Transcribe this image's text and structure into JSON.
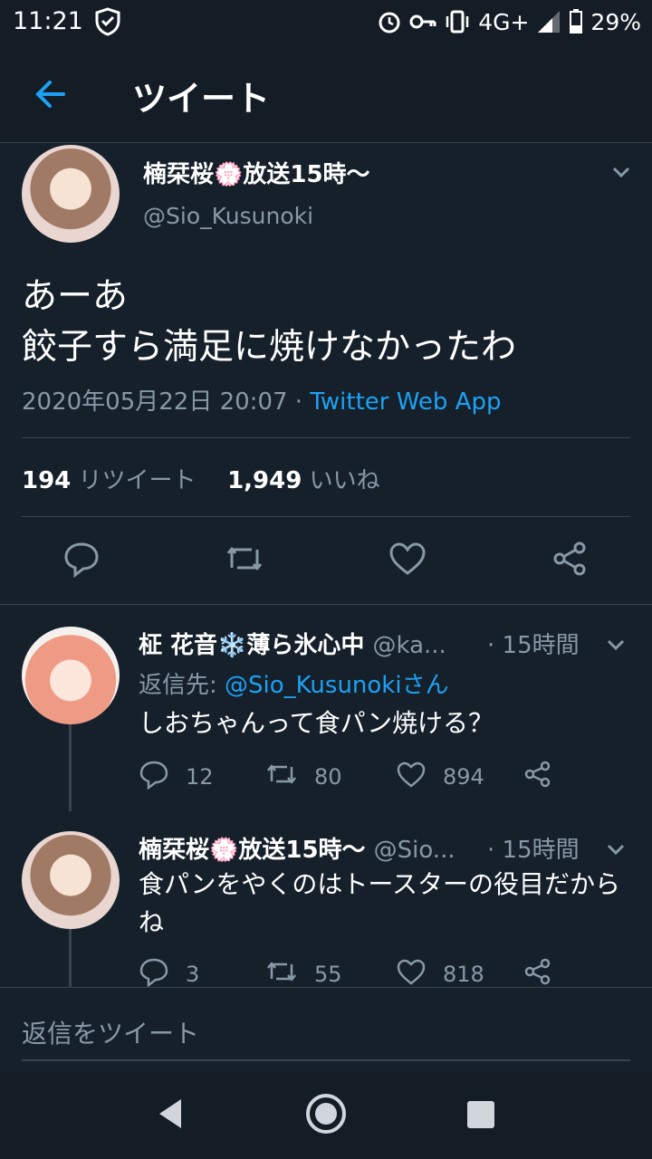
{
  "status_bar": {
    "time": "11:21",
    "network": "4G+",
    "battery": "29%"
  },
  "header": {
    "title": "ツイート"
  },
  "main_tweet": {
    "display_name": "楠栞桜💮放送15時〜",
    "handle": "@Sio_Kusunoki",
    "text": "あーあ\n餃子すら満足に焼けなかったわ",
    "date": "2020年05月22日 20:07",
    "separator": " · ",
    "source": "Twitter Web App",
    "retweet_count": "194",
    "retweet_label": "リツイート",
    "like_count": "1,949",
    "like_label": "いいね"
  },
  "replies": [
    {
      "display_name": "柾 花音❄️薄ら氷心中",
      "handle": "@ka...",
      "time": "· 15時間",
      "reply_to_label": "返信先: ",
      "reply_to_handle": "@Sio_Kusunokiさん",
      "text": "しおちゃんって食パン焼ける？",
      "reply_count": "12",
      "retweet_count": "80",
      "like_count": "894"
    },
    {
      "display_name": "楠栞桜💮放送15時〜",
      "handle": "@Sio...",
      "time": "· 15時間",
      "text": "食パンをやくのはトースターの役目だからね",
      "reply_count": "3",
      "retweet_count": "55",
      "like_count": "818"
    }
  ],
  "compose": {
    "placeholder": "返信をツイート"
  },
  "colors": {
    "background": "#15202b",
    "accent": "#1da1f2",
    "muted": "#8899a6",
    "border": "#38444d"
  }
}
